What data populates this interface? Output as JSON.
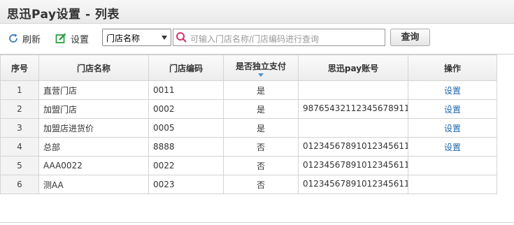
{
  "header": {
    "title": "思迅Pay设置 - 列表"
  },
  "toolbar": {
    "refresh_label": "刷新",
    "settings_label": "设置",
    "search_field_selected": "门店名称",
    "search_placeholder": "可输入门店名称/门店编码进行查询",
    "query_label": "查询"
  },
  "table": {
    "columns": [
      "序号",
      "门店名称",
      "门店编码",
      "是否独立支付",
      "思迅pay账号",
      "操作"
    ],
    "rows": [
      {
        "index": "1",
        "name": "直营门店",
        "code": "0011",
        "independent": "是",
        "account": "",
        "action": "设置"
      },
      {
        "index": "2",
        "name": "加盟门店",
        "code": "0002",
        "independent": "是",
        "account": "98765432112345678911",
        "action": "设置"
      },
      {
        "index": "3",
        "name": "加盟店进货价",
        "code": "0005",
        "independent": "是",
        "account": "",
        "action": "设置"
      },
      {
        "index": "4",
        "name": "总部",
        "code": "8888",
        "independent": "否",
        "account": "01234567891012345611",
        "action": "设置"
      },
      {
        "index": "5",
        "name": "AAA0022",
        "code": "0022",
        "independent": "否",
        "account": "01234567891012345611",
        "action": ""
      },
      {
        "index": "6",
        "name": "测AA",
        "code": "0023",
        "independent": "否",
        "account": "01234567891012345611",
        "action": ""
      }
    ]
  },
  "icons": {
    "refresh": "refresh-icon",
    "settings": "edit-icon",
    "search": "search-icon",
    "sort": "sort-down-icon"
  },
  "colors": {
    "link": "#1f66b0",
    "refresh_icon": "#3a78c2",
    "settings_icon": "#2f9e44",
    "search_icon": "#d6336c",
    "sort_arrow": "#4a8fd4"
  }
}
